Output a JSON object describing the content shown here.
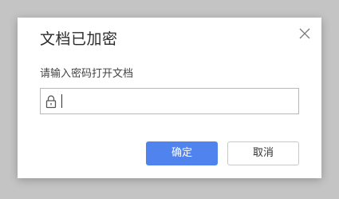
{
  "dialog": {
    "title": "文档已加密",
    "prompt": "请输入密码打开文档",
    "password": {
      "value": "",
      "placeholder": ""
    },
    "ok_label": "确定",
    "cancel_label": "取消"
  },
  "icons": {
    "close": "close-icon",
    "lock": "lock-icon"
  },
  "colors": {
    "accent": "#5183ee",
    "backdrop": "#c4c4c4"
  }
}
